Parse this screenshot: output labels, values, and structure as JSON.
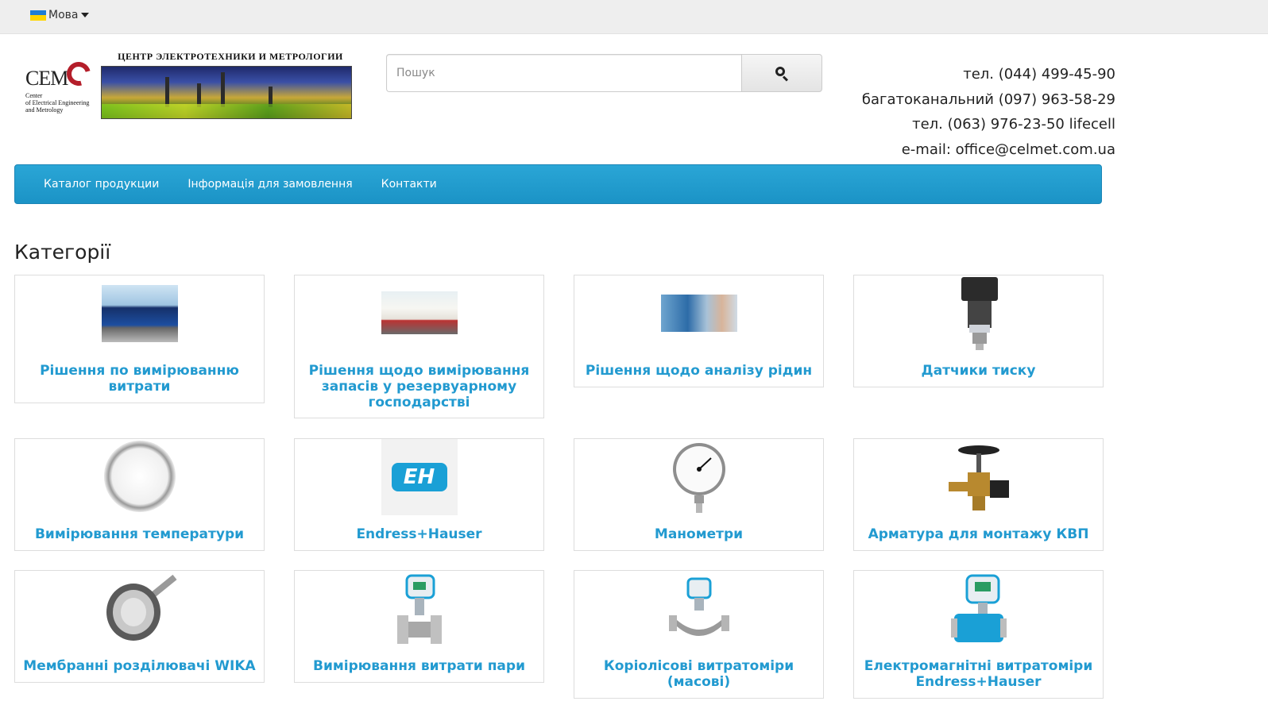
{
  "topbar": {
    "language_label": "Мова",
    "flag_colors": [
      "#1e7ed6",
      "#ffd500"
    ]
  },
  "logo": {
    "short": "CEM",
    "subtitle": "Center\nof Electrical Engineering\nand Metrology",
    "banner_title": "ЦЕНТР ЭЛЕКТРОТЕХНИКИ И МЕТРОЛОГИИ"
  },
  "search": {
    "placeholder": "Пошук",
    "button_icon": "search-icon"
  },
  "contacts": {
    "phone1": "тел. (044) 499-45-90",
    "phone2": "багатоканальний (097) 963-58-29",
    "phone3": "тел. (063) 976-23-50 lifecell",
    "email": "e-mail: office@celmet.com.ua"
  },
  "nav": {
    "items": [
      {
        "label": "Каталог продукции"
      },
      {
        "label": "Інформація для замовлення"
      },
      {
        "label": "Контакти"
      }
    ]
  },
  "heading": "Категорії",
  "categories": [
    {
      "title": "Рішення по вимірюванню витрати",
      "icon": "tanker-truck-image"
    },
    {
      "title": "Рішення щодо вимірювання запасів у резервуарному господарстві",
      "icon": "storage-tank-image"
    },
    {
      "title": "Рішення щодо аналізу рідин",
      "icon": "liquid-analysis-image"
    },
    {
      "title": "Датчики тиску",
      "icon": "pressure-sensor-image"
    },
    {
      "title": "Вимірювання температури",
      "icon": "thermometer-image"
    },
    {
      "title": "Endress+Hauser",
      "icon": "endress-hauser-logo"
    },
    {
      "title": "Манометри",
      "icon": "pressure-gauge-image"
    },
    {
      "title": "Арматура для монтажу КВП",
      "icon": "valve-image"
    },
    {
      "title": "Мембранні розділювачі WIKA",
      "icon": "diaphragm-seal-image"
    },
    {
      "title": "Вимірювання витрати пари",
      "icon": "steam-flowmeter-image"
    },
    {
      "title": "Коріолісові витратоміри (масові)",
      "icon": "coriolis-flowmeter-image"
    },
    {
      "title": "Електромагнітні витратоміри Endress+Hauser",
      "icon": "magnetic-flowmeter-image"
    }
  ],
  "brand_colors": {
    "nav": "#1b93c6",
    "link": "#229ad0",
    "logo_red": "#b41e2a"
  }
}
